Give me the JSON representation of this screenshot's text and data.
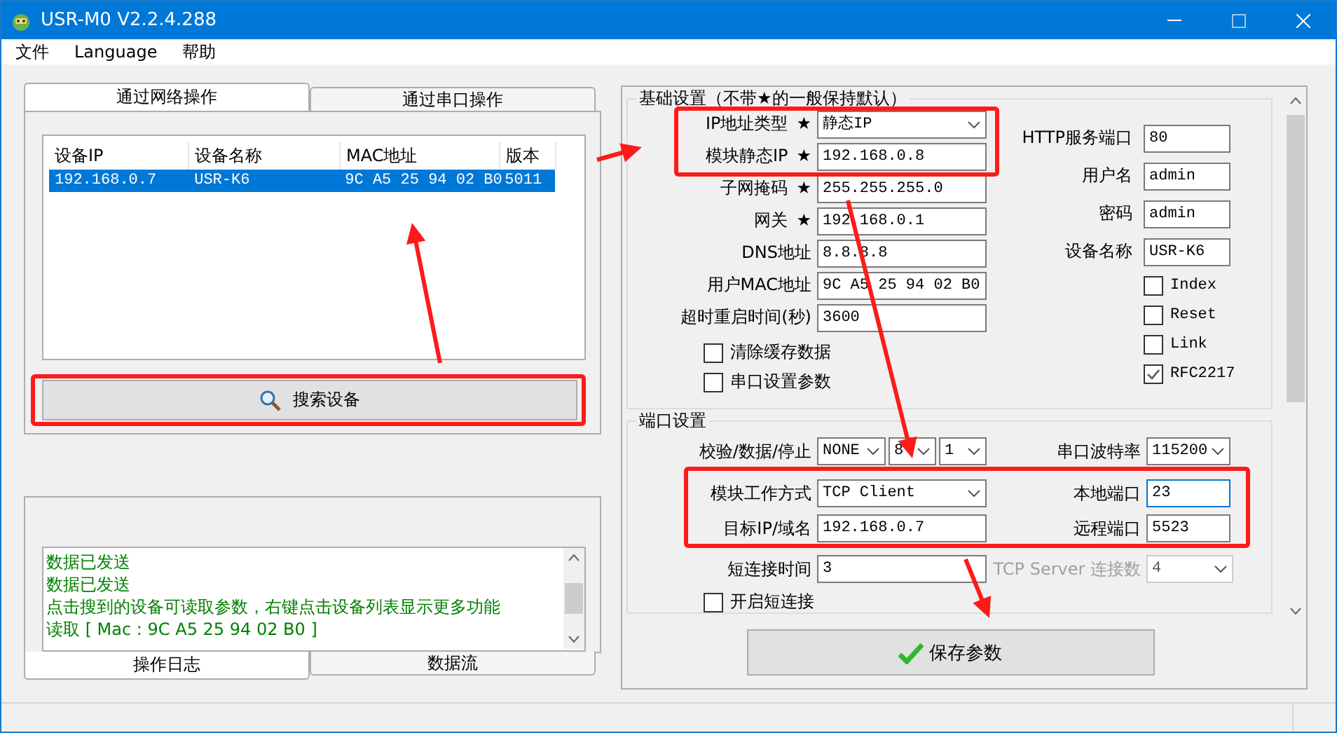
{
  "window": {
    "title": "USR-M0 V2.2.4.288"
  },
  "menu": [
    "文件",
    "Language",
    "帮助"
  ],
  "top_tabs": [
    {
      "label": "通过网络操作",
      "selected": true
    },
    {
      "label": "通过串口操作",
      "selected": false
    }
  ],
  "device_table": {
    "columns": [
      "设备IP",
      "设备名称",
      "MAC地址",
      "版本"
    ],
    "rows": [
      {
        "cells": [
          "192.168.0.7",
          "USR-K6",
          "9C A5 25 94 02 B0",
          "5011"
        ],
        "selected": true
      }
    ]
  },
  "search_button": "搜索设备",
  "log": [
    "数据已发送",
    "数据已发送",
    "点击搜到的设备可读取参数，右键点击设备列表显示更多功能",
    "读取 [ Mac : 9C A5 25 94 02 B0 ]"
  ],
  "bottom_tabs": [
    {
      "label": "操作日志",
      "selected": true
    },
    {
      "label": "数据流",
      "selected": false
    }
  ],
  "basic": {
    "title": "基础设置（不带★的一般保持默认）",
    "fields": [
      {
        "label": "IP地址类型",
        "marker": "★",
        "kind": "select",
        "value": "静态IP"
      },
      {
        "label": "模块静态IP",
        "marker": "★",
        "kind": "input",
        "value": "192.168.0.8"
      },
      {
        "label": "子网掩码",
        "marker": "★",
        "kind": "input",
        "value": "255.255.255.0"
      },
      {
        "label": "网关",
        "marker": "★",
        "kind": "input",
        "value": "192.168.0.1"
      },
      {
        "label": "DNS地址",
        "kind": "input",
        "value": "8.8.8.8"
      },
      {
        "label": "用户MAC地址",
        "kind": "input",
        "value": "9C A5 25 94 02 B0"
      },
      {
        "label": "超时重启时间(秒)",
        "kind": "input",
        "value": "3600"
      }
    ],
    "options": [
      {
        "label": "清除缓存数据",
        "checked": false
      },
      {
        "label": "串口设置参数",
        "checked": false
      }
    ],
    "side_fields": [
      {
        "label": "HTTP服务端口",
        "value": "80"
      },
      {
        "label": "用户名",
        "value": "admin"
      },
      {
        "label": "密码",
        "value": "admin"
      },
      {
        "label": "设备名称",
        "value": "USR-K6"
      }
    ],
    "flags": [
      {
        "label": "Index",
        "checked": false
      },
      {
        "label": "Reset",
        "checked": false
      },
      {
        "label": "Link",
        "checked": false
      },
      {
        "label": "RFC2217",
        "checked": true
      }
    ]
  },
  "port": {
    "title": "端口设置",
    "serial_label": "校验/数据/停止",
    "parity": "NONE",
    "data_bits": "8",
    "stop_bits": "1",
    "baud_label": "串口波特率",
    "baud": "115200",
    "mode_label": "模块工作方式",
    "mode": "TCP Client",
    "local_port_label": "本地端口",
    "local_port": "23",
    "target_label": "目标IP/域名",
    "target": "192.168.0.7",
    "remote_port_label": "远程端口",
    "remote_port": "5523",
    "short_time_label": "短连接时间",
    "short_time": "3",
    "server_label": "TCP Server 连接数",
    "server_count": "4",
    "server_disabled": true,
    "short_conn": {
      "label": "开启短连接",
      "checked": false
    }
  },
  "save_button": "保存参数"
}
